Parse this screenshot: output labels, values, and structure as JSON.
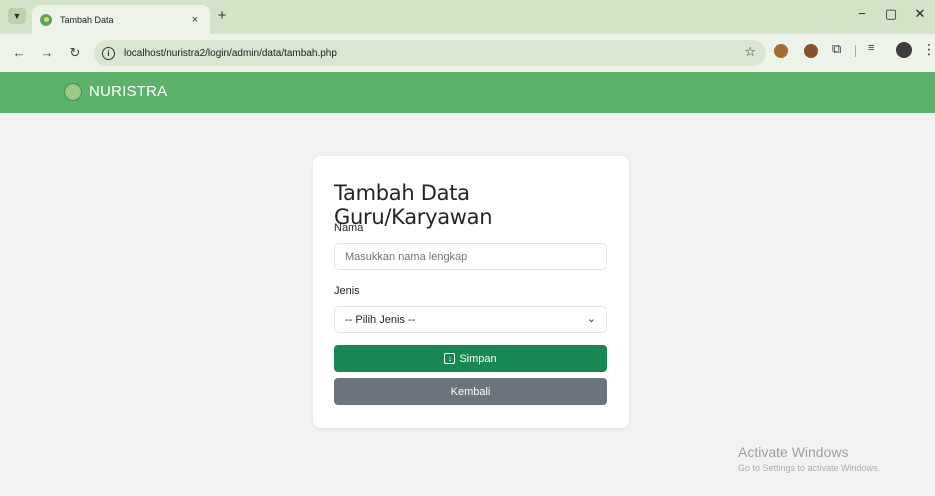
{
  "browser": {
    "tab_title": "Tambah Data",
    "tab_close": "×",
    "new_tab": "+",
    "url": "localhost/nuristra2/login/admin/data/tambah.php",
    "icons": [
      "chevron-down-icon",
      "favicon-icon",
      "close-icon",
      "plus-icon",
      "minimize-icon",
      "maximize-icon",
      "back-icon",
      "forward-icon",
      "reload-icon",
      "info-icon",
      "star-icon",
      "cookie-extension-icon",
      "cookie-extension-icon",
      "puzzle-icon",
      "reading-list-icon",
      "profile-avatar",
      "menu-icon"
    ],
    "controls": {
      "minimize": "−",
      "maximize": "▢",
      "close": "✕"
    }
  },
  "app": {
    "brand": "NURISTRA",
    "accent_color": "#5cb26a"
  },
  "form": {
    "title": "Tambah Data Guru/Karyawan",
    "nama_label": "Nama",
    "nama_placeholder": "Masukkan nama lengkap",
    "jenis_label": "Jenis",
    "jenis_selected": "-- Pilih Jenis --",
    "save_label": "Simpan",
    "back_label": "Kembali",
    "save_color": "#198754",
    "back_color": "#6c757d"
  },
  "watermark": {
    "title": "Activate Windows",
    "subtitle": "Go to Settings to activate Windows."
  }
}
